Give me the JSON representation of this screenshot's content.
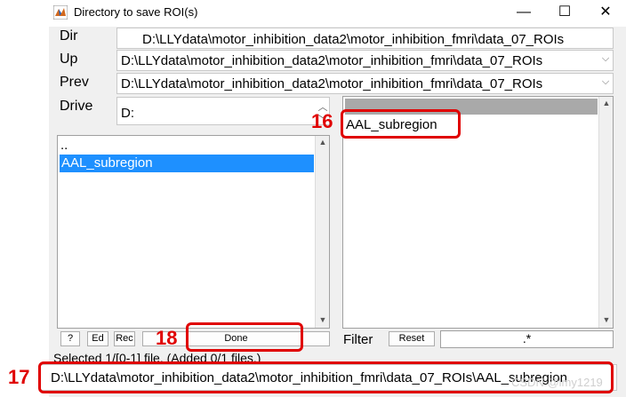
{
  "window": {
    "title": "Directory to save ROI(s)",
    "minimize_glyph": "—",
    "maximize_glyph": "☐",
    "close_glyph": "✕"
  },
  "form": {
    "dir_label": "Dir",
    "dir_value": "D:\\LLYdata\\motor_inhibition_data2\\motor_inhibition_fmri\\data_07_ROIs",
    "up_label": "Up",
    "up_value": "D:\\LLYdata\\motor_inhibition_data2\\motor_inhibition_fmri\\data_07_ROIs",
    "prev_label": "Prev",
    "prev_value": "D:\\LLYdata\\motor_inhibition_data2\\motor_inhibition_fmri\\data_07_ROIs",
    "drive_label": "Drive",
    "drive_value": "D:"
  },
  "left_list": {
    "items": [
      "..",
      "AAL_subregion"
    ],
    "selected_index": 1
  },
  "right_list": {
    "items": [
      "AAL_subregion"
    ]
  },
  "buttons": {
    "help": "?",
    "ed": "Ed",
    "rec": "Rec",
    "done": "Done",
    "reset": "Reset"
  },
  "filter": {
    "label": "Filter",
    "value": ".*"
  },
  "status": "Selected 1/[0-1] file. (Added 0/1 files.)",
  "selected_path": "D:\\LLYdata\\motor_inhibition_data2\\motor_inhibition_fmri\\data_07_ROIs\\AAL_subregion",
  "annotations": {
    "n16": "16",
    "n17": "17",
    "n18": "18"
  },
  "watermark": "CSDN @lmy1219",
  "colors": {
    "selection": "#1e90ff",
    "annotation": "#e00000",
    "panel": "#f0f0f0"
  }
}
